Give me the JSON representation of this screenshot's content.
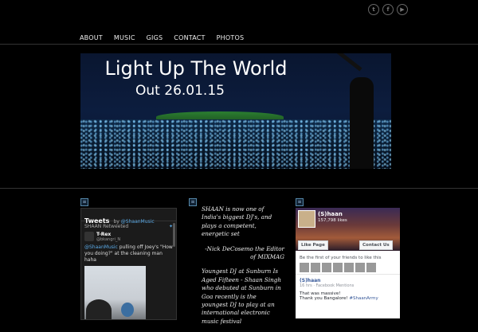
{
  "social": {
    "icons": [
      "twitter-icon",
      "facebook-icon",
      "youtube-icon"
    ],
    "glyphs": [
      "t",
      "f",
      "▶"
    ]
  },
  "nav": {
    "items": [
      "ABOUT",
      "MUSIC",
      "GIGS",
      "CONTACT",
      "PHOTOS"
    ]
  },
  "hero": {
    "title": "Light Up The World",
    "subtitle": "Out 26.01.15"
  },
  "twitter": {
    "title": "Tweets",
    "by_prefix": "by",
    "by_handle": "@ShaanMusic",
    "retweet_line": "SHAAN Retweeted",
    "user_name": "T-Rex",
    "user_handle": "@bkangri_N",
    "tweet_mention": "@ShaanMusic",
    "tweet_text": " pulling off Joey's \"How you doing?\" at the cleaning man haha"
  },
  "quote": {
    "p1": "SHAAN is now one of India's biggest DJ's, and plays a competent, energetic set",
    "p2": "-Nick DeCosemo the Editor of MIXMAG",
    "p3": "Youngest DJ at Sunburn Is Aged Fifteen - Shaan Singh who debuted at Sunburn in Goa recently is the youngest DJ to play at an international electronic music festival"
  },
  "facebook": {
    "page_name": "(S)haan",
    "likes": "157,798 likes",
    "like_button": "Like Page",
    "contact_button": "Contact Us",
    "friends_text": "Be the first of your friends to like this",
    "post_name": "(S)haan",
    "post_meta": "16 hrs · Facebook Mentions",
    "post_line1": "That was massive!",
    "post_line2_prefix": "Thank you Bangalore! ",
    "post_tag": "#ShaanArmy"
  },
  "colors": {
    "link": "#5aa9e6",
    "fb_link": "#365899",
    "background": "#000000"
  }
}
